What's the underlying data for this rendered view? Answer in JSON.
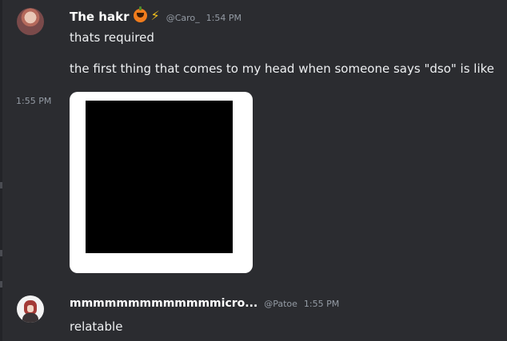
{
  "messages": [
    {
      "username": "The hakr",
      "badges": [
        "pumpkin-emoji",
        "lightning-emoji"
      ],
      "badge_glyphs": {
        "lightning": "⚡"
      },
      "handle": "@Caro_",
      "time": "1:54 PM",
      "lines": [
        "thats required",
        "the first thing that comes to my head when someone says \"dso\" is like"
      ]
    },
    {
      "continuation_time": "1:55 PM",
      "attachment": "image"
    },
    {
      "username": "mmmmmmmmmmmmmicro...",
      "handle": "@Patoe",
      "time": "1:55 PM",
      "lines": [
        "relatable"
      ]
    }
  ],
  "colors": {
    "background": "#2b2c30",
    "username": "#ffffff",
    "meta": "#949ba4",
    "text": "#eef0f2"
  }
}
